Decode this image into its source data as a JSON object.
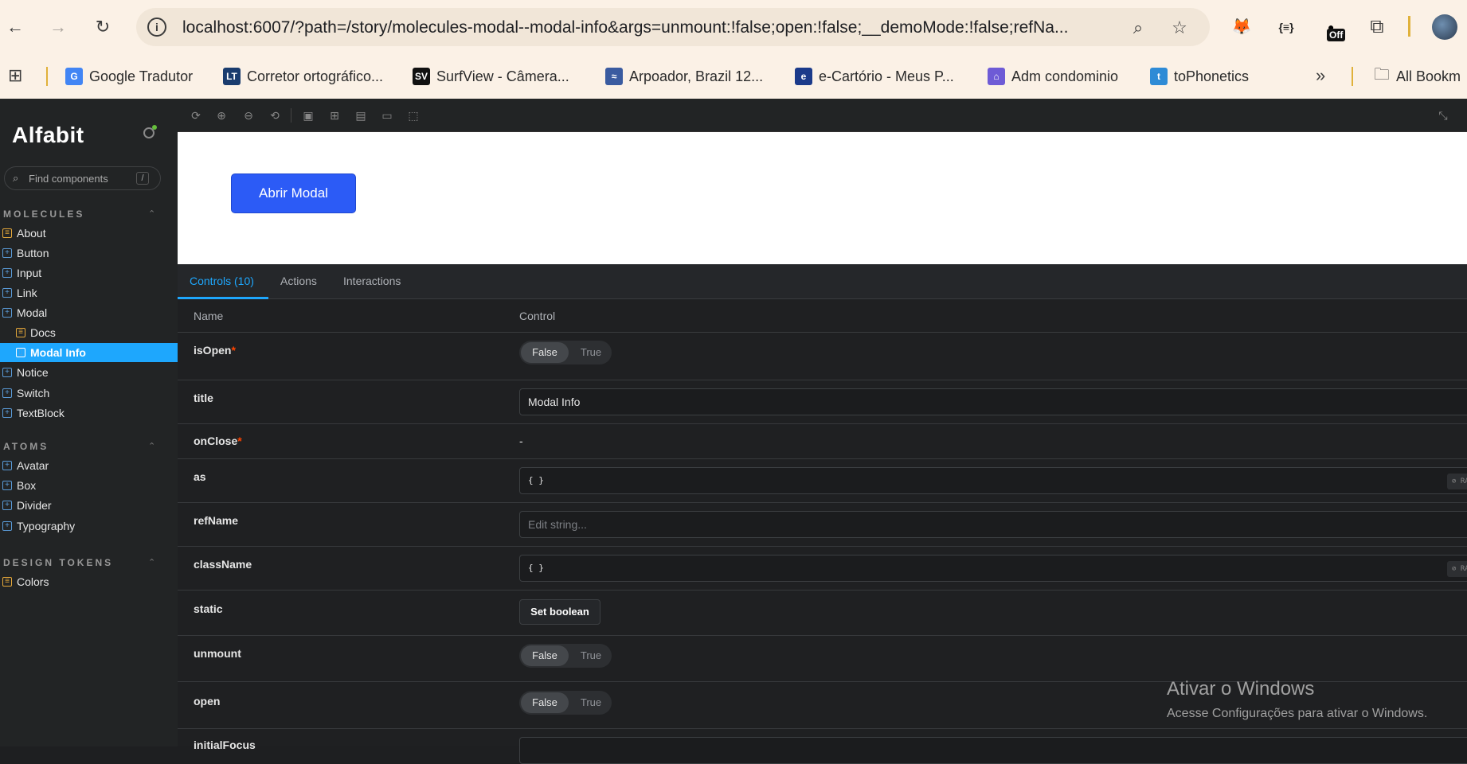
{
  "browser": {
    "url": "localhost:6007/?path=/story/molecules-modal--modal-info&args=unmount:!false;open:!false;__demoMode:!false;refNa...",
    "bookmarks": [
      {
        "label": "Google Tradutor",
        "color": "#4285f4",
        "glyph": "G"
      },
      {
        "label": "Corretor ortográfico...",
        "color": "#1a3c6e",
        "glyph": "LT"
      },
      {
        "label": "SurfView - Câmera...",
        "color": "#111111",
        "glyph": "SV"
      },
      {
        "label": "Arpoador, Brazil 12...",
        "color": "#3a5ba0",
        "glyph": "≈"
      },
      {
        "label": "e-Cartório - Meus P...",
        "color": "#1b3a8a",
        "glyph": "e"
      },
      {
        "label": "Adm condominio",
        "color": "#6e5bd6",
        "glyph": "⌂"
      },
      {
        "label": "toPhonetics",
        "color": "#2e8bd6",
        "glyph": "t"
      }
    ],
    "bookmarks_more": "»",
    "all_bookmarks": "All Bookm",
    "ext_off_label": "Off"
  },
  "storybook": {
    "brand": "Alfabit",
    "search_placeholder": "Find components",
    "search_shortcut": "/",
    "groups": [
      {
        "title": "MOLECULES"
      },
      {
        "title": "ATOMS"
      },
      {
        "title": "DESIGN TOKENS"
      }
    ],
    "molecules": [
      "About",
      "Button",
      "Input",
      "Link",
      "Modal",
      "Docs",
      "Modal Info",
      "Notice",
      "Switch",
      "TextBlock"
    ],
    "atoms": [
      "Avatar",
      "Box",
      "Divider",
      "Typography"
    ],
    "tokens": [
      "Colors"
    ],
    "canvas_button": "Abrir Modal",
    "tabs": [
      "Controls (10)",
      "Actions",
      "Interactions"
    ],
    "table_head": {
      "name": "Name",
      "control": "Control"
    },
    "rows": [
      {
        "name": "isOpen",
        "required": "*",
        "false": "False",
        "true": "True"
      },
      {
        "name": "title",
        "value": "Modal Info"
      },
      {
        "name": "onClose",
        "required": "*",
        "value": "-"
      },
      {
        "name": "as",
        "value": "{ }",
        "raw": "RAW"
      },
      {
        "name": "refName",
        "placeholder": "Edit string..."
      },
      {
        "name": "className",
        "value": "{ }",
        "raw": "RAW"
      },
      {
        "name": "static",
        "button": "Set boolean"
      },
      {
        "name": "unmount",
        "false": "False",
        "true": "True"
      },
      {
        "name": "open",
        "false": "False",
        "true": "True"
      },
      {
        "name": "initialFocus"
      }
    ]
  },
  "watermark": {
    "line1": "Ativar o Windows",
    "line2": "Acesse Configurações para ativar o Windows."
  }
}
